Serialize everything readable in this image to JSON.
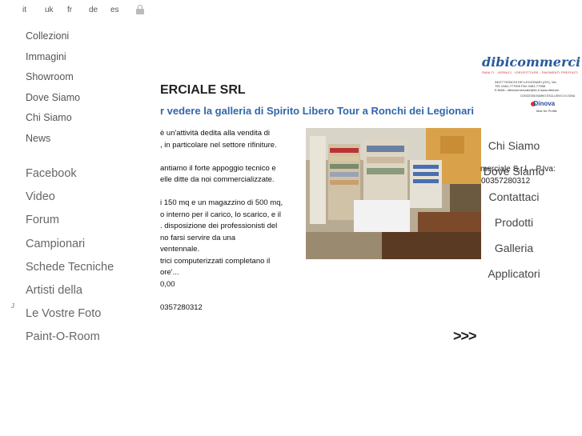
{
  "languages": [
    "it",
    "uk",
    "fr",
    "de",
    "es"
  ],
  "nav_primary": [
    "Collezioni",
    "Immagini",
    "Showroom",
    "Dove Siamo",
    "Chi Siamo",
    "News"
  ],
  "nav_secondary": [
    "Facebook",
    "Video",
    "Forum",
    "Campionari",
    "Schede Tecniche",
    "Artisti della",
    "Le Vostre Foto",
    "Paint-O-Room"
  ],
  "stray_glyph": "J",
  "company_title": "ERCIALE SRL",
  "gallery_link": "r vedere la galleria di Spirito Libero Tour a Ronchi dei Legionari",
  "description_lines": [
    "è un'attività dedita alla vendita di",
    ", in particolare nel settore rifiniture.",
    "",
    "antiamo il forte appoggio tecnico e",
    "elle ditte da noi commercializzate.",
    "",
    "i 150 mq e un magazzino di 500 mq,",
    "o interno per il carico, lo scarico, e il",
    ". disposizione dei professionisti del",
    "no farsi servire da una",
    "ventennale.",
    "trici computerizzati completano il",
    "ore'...",
    "0,00",
    "",
    "0357280312"
  ],
  "logo": {
    "name": "dibicommerci",
    "tagline": "SMALTI · VERNICI · IDROPITTURE · PAVIMENTI PREFINITI",
    "address_line1": "34077 RONCHI DEI LEGIONARI (GO), Via",
    "address_line2": "TEL 0481-777005  FAX 0481-77968",
    "address_line3": "E-MAIL: dibicommerciale@tin.it  www.dibicom",
    "concession": "CONCESSIONARIO ESCLUSIVO DI ZONA",
    "brand": "Dinova",
    "brand_sub": "Max for Profile"
  },
  "nav_right": [
    "Chi Siamo",
    "Dove Siamo",
    "Contattaci",
    "Prodotti",
    "Galleria",
    "Applicatori"
  ],
  "overlap_text": "merciale S.r.l. · P.Iva:",
  "phone_right": "00357280312",
  "more_arrows": ">>>"
}
